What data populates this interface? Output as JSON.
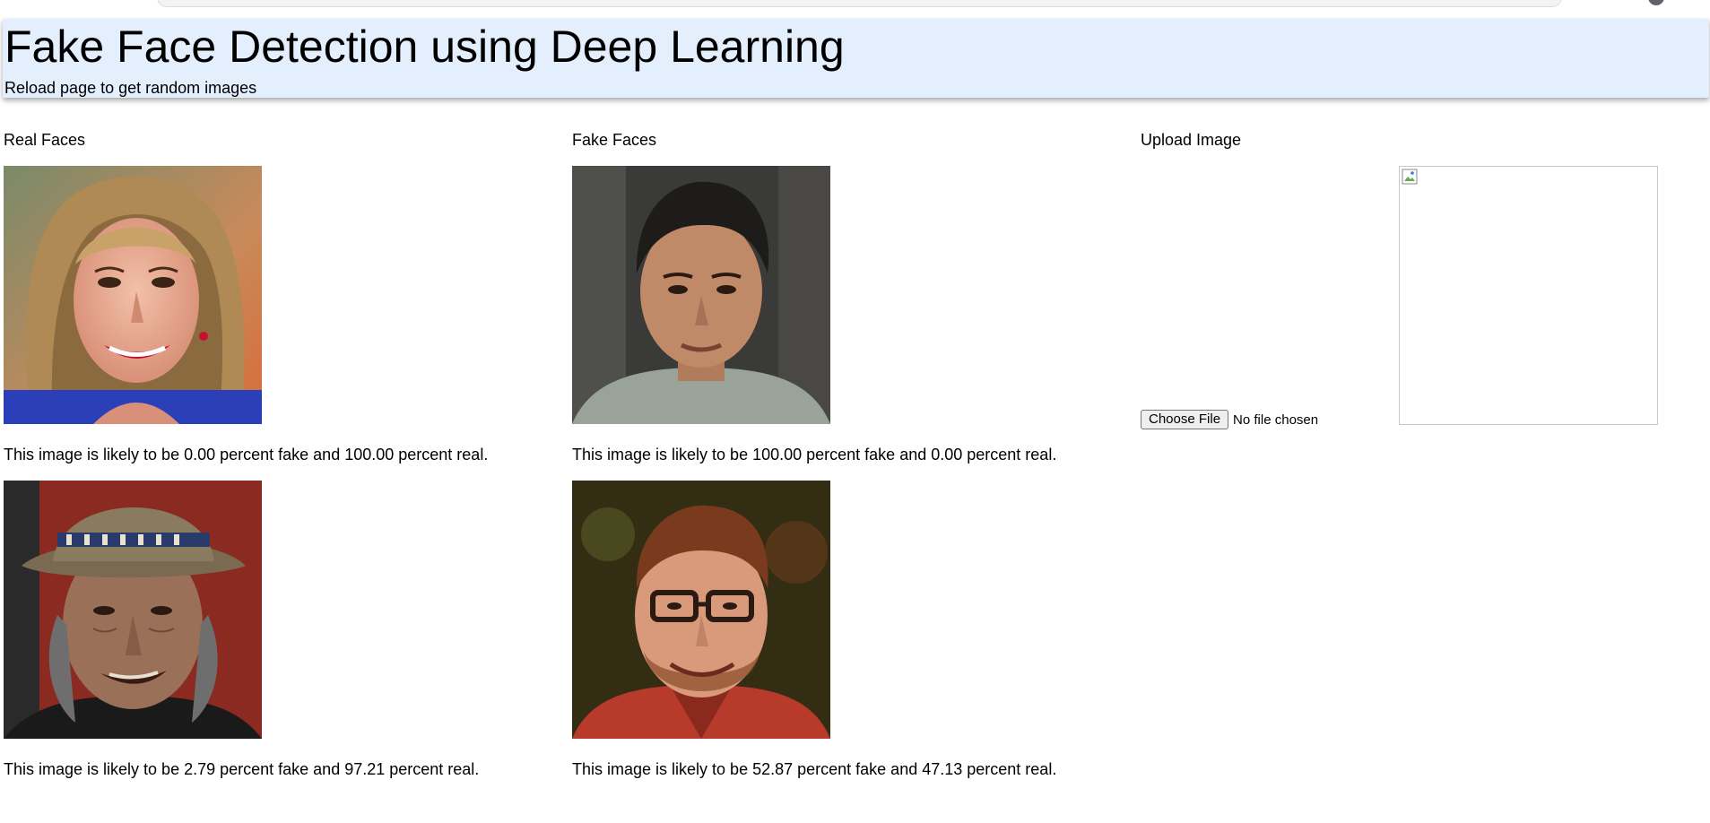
{
  "header": {
    "title": "Fake Face Detection using Deep Learning",
    "subtitle": "Reload page to get random images"
  },
  "columns": {
    "real_title": "Real Faces",
    "fake_title": "Fake Faces",
    "upload_title": "Upload Image"
  },
  "real_faces": [
    {
      "caption": "This image is likely to be 0.00 percent fake and 100.00 percent real.",
      "fake_percent": 0.0,
      "real_percent": 100.0
    },
    {
      "caption": "This image is likely to be 2.79 percent fake and 97.21 percent real.",
      "fake_percent": 2.79,
      "real_percent": 97.21
    }
  ],
  "fake_faces": [
    {
      "caption": "This image is likely to be 100.00 percent fake and 0.00 percent real.",
      "fake_percent": 100.0,
      "real_percent": 0.0
    },
    {
      "caption": "This image is likely to be 52.87 percent fake and 47.13 percent real.",
      "fake_percent": 52.87,
      "real_percent": 47.13
    }
  ],
  "upload": {
    "button_label": "Choose File",
    "status": "No file chosen"
  },
  "colors": {
    "header_bg": "#e3effd"
  }
}
